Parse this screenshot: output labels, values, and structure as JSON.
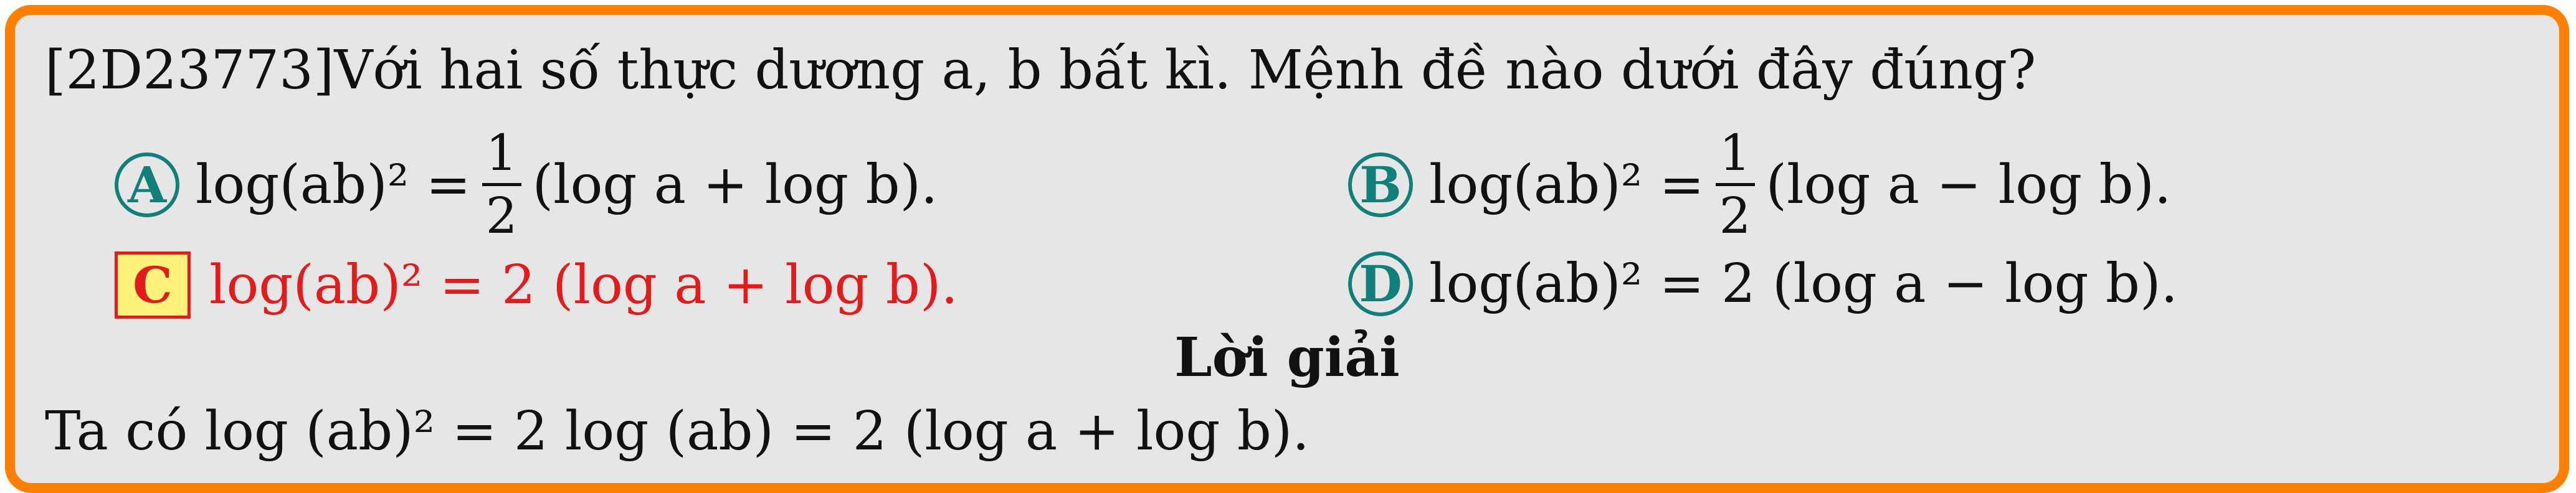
{
  "question": {
    "text": "[2D23773]Với hai số thực dương a, b bất kì. Mệnh đề nào dưới đây đúng?"
  },
  "options": [
    {
      "label": "A",
      "before": "log(ab)² = ",
      "frac_num": "1",
      "frac_den": "2",
      "after": "(log a + log b).",
      "correct": false
    },
    {
      "label": "B",
      "before": "log(ab)² = ",
      "frac_num": "1",
      "frac_den": "2",
      "after": "(log a − log b).",
      "correct": false
    },
    {
      "label": "C",
      "text": "log(ab)² = 2 (log a + log b).",
      "correct": true
    },
    {
      "label": "D",
      "text": "log(ab)² = 2 (log a − log b).",
      "correct": false
    }
  ],
  "solution": {
    "title": "Lời giải",
    "text": "Ta có log (ab)² = 2 log (ab) = 2 (log a + log b)."
  },
  "colors": {
    "frame_border": "#ff8000",
    "background": "#e6e6e6",
    "option_badge": "#11807a",
    "correct_answer": "#e31b1b",
    "correct_badge_fill": "#fff27a"
  }
}
